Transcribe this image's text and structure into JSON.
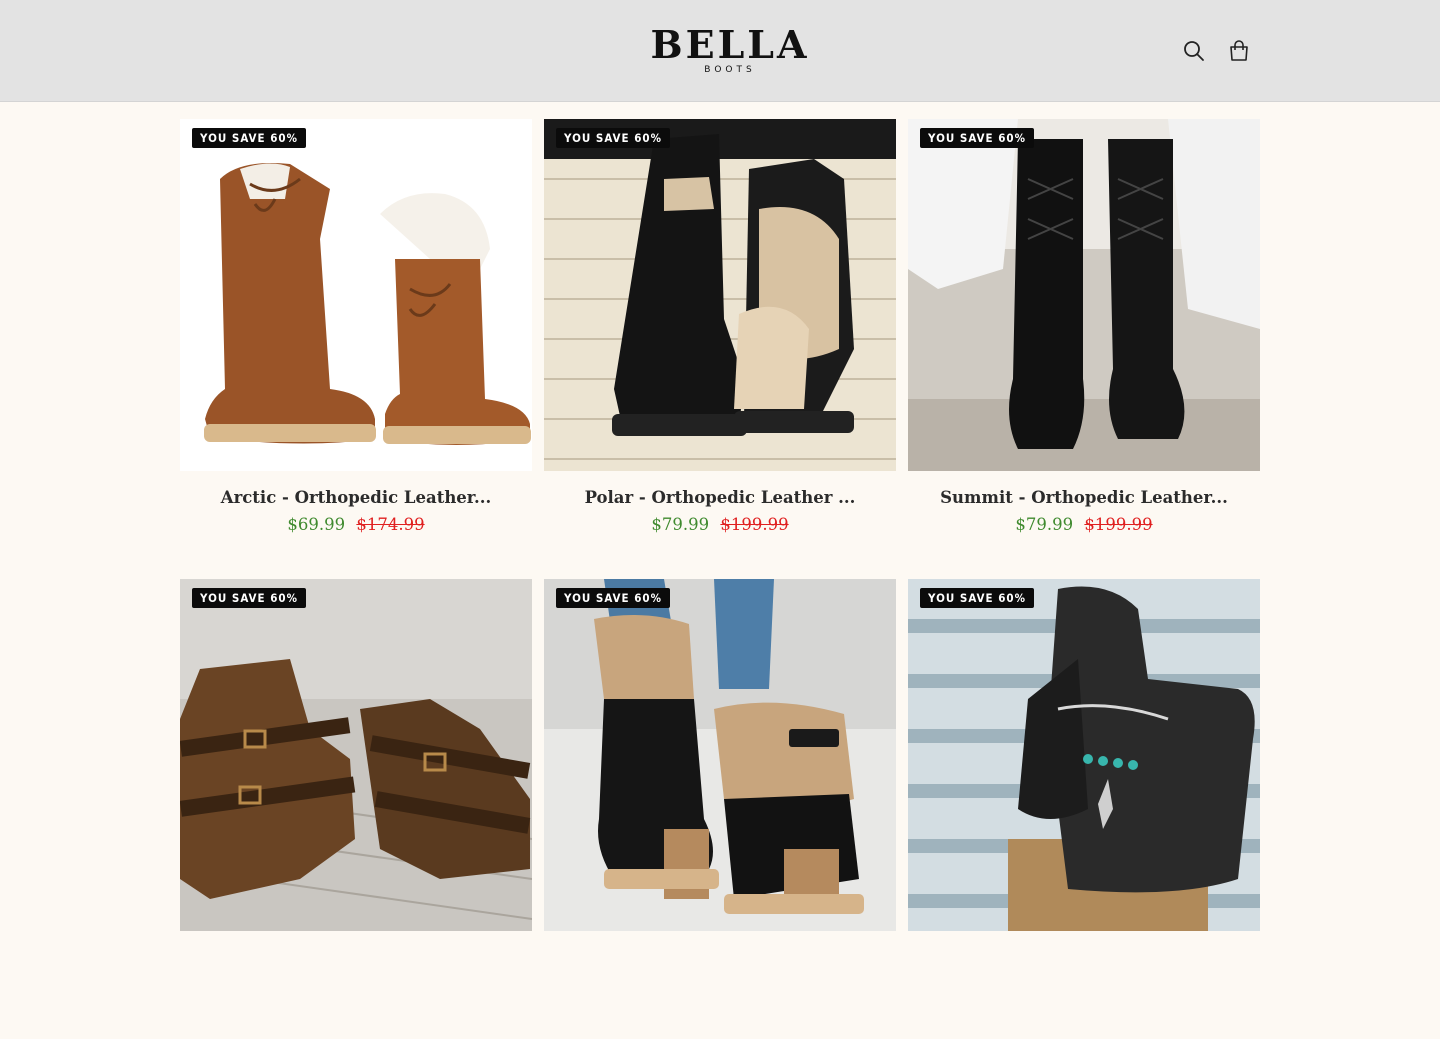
{
  "brand": {
    "name": "BELLA",
    "tagline": "BOOTS"
  },
  "header": {
    "search_icon": "search-icon",
    "cart_icon": "shopping-bag-icon"
  },
  "colors": {
    "header_bg": "#e3e3e3",
    "page_bg": "#fdf9f3",
    "price": "#3f8a2e",
    "compare_price": "#e02020",
    "badge_bg": "#0b0b0b"
  },
  "products": [
    {
      "badge": "YOU SAVE 60%",
      "title": "Arctic - Orthopedic Leather...",
      "price": "$69.99",
      "compare_price": "$174.99"
    },
    {
      "badge": "YOU SAVE 60%",
      "title": "Polar - Orthopedic Leather ...",
      "price": "$79.99",
      "compare_price": "$199.99"
    },
    {
      "badge": "YOU SAVE 60%",
      "title": "Summit - Orthopedic Leather...",
      "price": "$79.99",
      "compare_price": "$199.99"
    },
    {
      "badge": "YOU SAVE 60%"
    },
    {
      "badge": "YOU SAVE 60%"
    },
    {
      "badge": "YOU SAVE 60%"
    }
  ]
}
